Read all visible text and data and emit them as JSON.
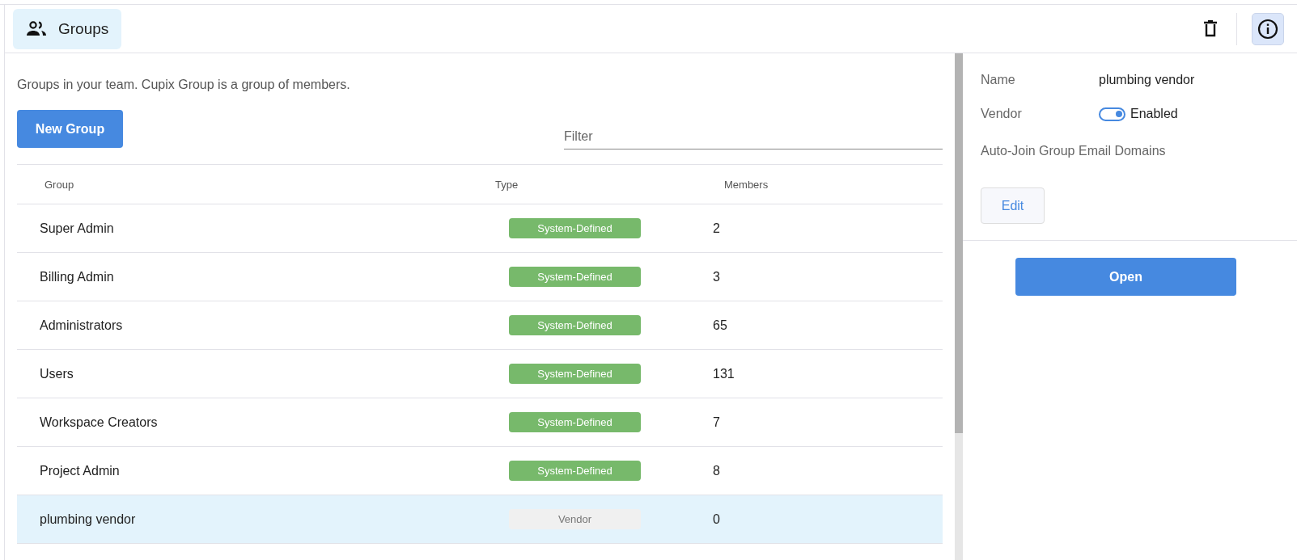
{
  "header": {
    "tab": {
      "label": "Groups",
      "selected": true
    },
    "info_button": {
      "selected": true
    }
  },
  "description": "Groups in your team. Cupix Group is a group of members.",
  "new_group_button": "New Group",
  "filter": {
    "placeholder": "Filter"
  },
  "table": {
    "columns": [
      "Group",
      "Type",
      "Members"
    ],
    "rows": [
      {
        "group": "Super Admin",
        "type": {
          "label": "System-Defined",
          "kind": "system"
        },
        "members": "2",
        "selected": false
      },
      {
        "group": "Billing Admin",
        "type": {
          "label": "System-Defined",
          "kind": "system"
        },
        "members": "3",
        "selected": false
      },
      {
        "group": "Administrators",
        "type": {
          "label": "System-Defined",
          "kind": "system"
        },
        "members": "65",
        "selected": false
      },
      {
        "group": "Users",
        "type": {
          "label": "System-Defined",
          "kind": "system"
        },
        "members": "131",
        "selected": false
      },
      {
        "group": "Workspace Creators",
        "type": {
          "label": "System-Defined",
          "kind": "system"
        },
        "members": "7",
        "selected": false
      },
      {
        "group": "Project Admin",
        "type": {
          "label": "System-Defined",
          "kind": "system"
        },
        "members": "8",
        "selected": false
      },
      {
        "group": "plumbing vendor",
        "type": {
          "label": "Vendor",
          "kind": "vendor"
        },
        "members": "0",
        "selected": true
      }
    ]
  },
  "details": {
    "name_label": "Name",
    "name_value": "plumbing vendor",
    "vendor_label": "Vendor",
    "vendor_toggle": {
      "on": true,
      "label": "Enabled"
    },
    "domains_label": "Auto-Join Group Email Domains",
    "edit_button": "Edit",
    "open_button": "Open"
  }
}
